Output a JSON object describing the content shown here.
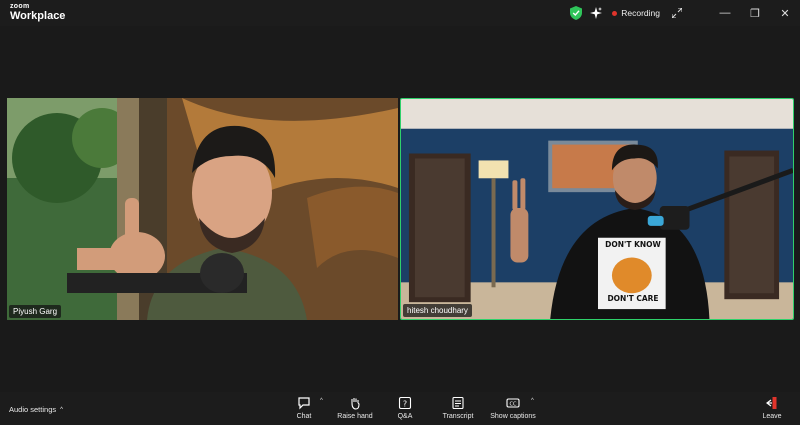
{
  "app": {
    "logo_line1": "zoom",
    "logo_line2": "Workplace"
  },
  "titlebar": {
    "recording_label": "Recording",
    "minimize": "—",
    "restore": "❐",
    "close": "✕"
  },
  "participants": [
    {
      "name": "Piyush Garg"
    },
    {
      "name": "hitesh choudhary"
    }
  ],
  "shirt_text": {
    "line1": "DON'T KNOW",
    "line2": "DON'T CARE"
  },
  "toolbar": {
    "audio_settings": "Audio settings",
    "chat": "Chat",
    "raise_hand": "Raise hand",
    "qa": "Q&A",
    "transcript": "Transcript",
    "show_captions": "Show captions",
    "leave": "Leave",
    "caret": "^"
  },
  "colors": {
    "active_speaker": "#2fd16b",
    "recording": "#e0342b",
    "leave": "#e0342b"
  }
}
